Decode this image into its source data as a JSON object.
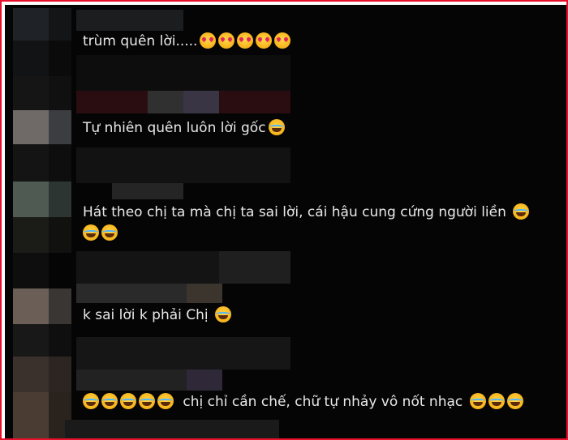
{
  "comments": [
    {
      "text": "trùm quên lời.....",
      "emojis": [
        "smiling-face-with-hearts-icon",
        "smiling-face-with-hearts-icon",
        "smiling-face-with-hearts-icon",
        "smiling-face-with-hearts-icon",
        "smiling-face-with-hearts-icon"
      ]
    },
    {
      "text": "Tự nhiên quên luôn lời gốc",
      "emojis": [
        "rolling-on-floor-laughing-icon"
      ]
    },
    {
      "text": "Hát theo chị ta mà chị ta sai lời, cái hậu cung cứng người liền",
      "emojis": [
        "face-with-tears-of-joy-icon",
        "face-with-tears-of-joy-icon",
        "face-with-tears-of-joy-icon"
      ]
    },
    {
      "text": "k sai lời k phải Chị",
      "emojis": [
        "face-with-tears-of-joy-icon"
      ]
    },
    {
      "text": "chị chỉ cần chế, chữ tự nhảy vô nốt nhạc",
      "lead_emojis": [
        "face-with-tears-of-joy-icon",
        "face-with-tears-of-joy-icon",
        "face-with-tears-of-joy-icon",
        "face-with-tears-of-joy-icon",
        "face-with-tears-of-joy-icon"
      ],
      "emojis": [
        "face-with-tears-of-joy-icon",
        "face-with-tears-of-joy-icon",
        "face-with-tears-of-joy-icon"
      ]
    }
  ],
  "colors": {
    "frame_border": "#e8102a",
    "background": "#050505",
    "text": "#e8e8e8"
  }
}
